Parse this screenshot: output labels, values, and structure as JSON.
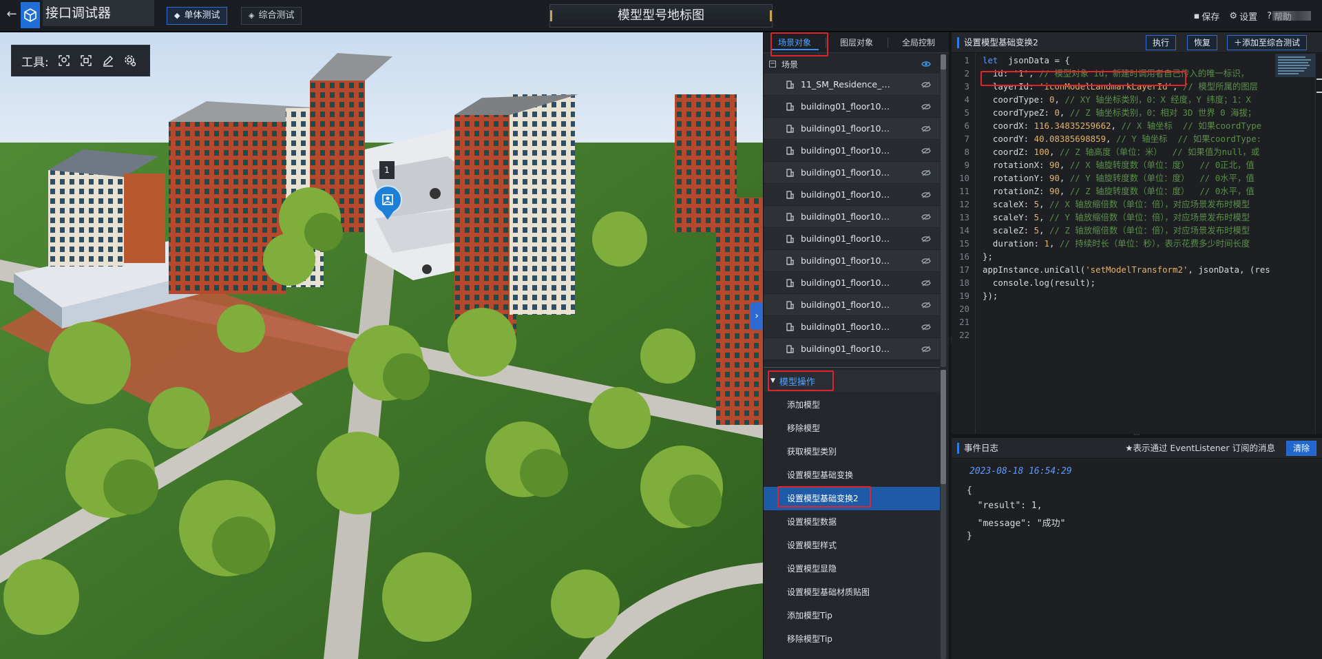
{
  "app": {
    "title": "接口调试器",
    "back_icon": "back-arrow-icon",
    "logo_icon": "cube-logo-icon"
  },
  "modes": [
    {
      "label": "单体测试",
      "active": true
    },
    {
      "label": "综合测试",
      "active": false
    }
  ],
  "page_title": "模型型号地标图",
  "top_actions": [
    {
      "label": "保存",
      "icon": "save-icon"
    },
    {
      "label": "设置",
      "icon": "settings-icon"
    },
    {
      "label": "帮助",
      "icon": "help-icon"
    }
  ],
  "toolbox": {
    "label": "工具:",
    "tools": [
      "locate-icon",
      "frame-select-icon",
      "pen-icon",
      "gear-icon"
    ]
  },
  "mid_tabs": [
    {
      "label": "场景对象",
      "active": true
    },
    {
      "label": "图层对象",
      "active": false
    },
    {
      "label": "全局控制",
      "active": false
    }
  ],
  "tree": {
    "root": "场景",
    "items": [
      "11_SM_Residence_00...",
      "building01_floor10_r...",
      "building01_floor10_r...",
      "building01_floor10_r...",
      "building01_floor10_r...",
      "building01_floor10_r...",
      "building01_floor10_r...",
      "building01_floor10_r...",
      "building01_floor10_r...",
      "building01_floor10_r...",
      "building01_floor10_r...",
      "building01_floor10_r...",
      "building01_floor10_r..."
    ]
  },
  "ops": {
    "header": "模型操作",
    "items": [
      {
        "label": "添加模型",
        "active": false
      },
      {
        "label": "移除模型",
        "active": false
      },
      {
        "label": "获取模型类别",
        "active": false
      },
      {
        "label": "设置模型基础变换",
        "active": false
      },
      {
        "label": "设置模型基础变换2",
        "active": true
      },
      {
        "label": "设置模型数据",
        "active": false
      },
      {
        "label": "设置模型样式",
        "active": false
      },
      {
        "label": "设置模型显隐",
        "active": false
      },
      {
        "label": "设置模型基础材质贴图",
        "active": false
      },
      {
        "label": "添加模型Tip",
        "active": false
      },
      {
        "label": "移除模型Tip",
        "active": false
      }
    ]
  },
  "editor": {
    "title": "设置模型基础变换2",
    "buttons": [
      "执行",
      "恢复",
      "添加至综合测试"
    ],
    "line_numbers": [
      "1",
      "2",
      "3",
      "4",
      "5",
      "6",
      "7",
      "8",
      "9",
      "10",
      "11",
      "12",
      "13",
      "14",
      "15",
      "16",
      "17",
      "18",
      "19",
      "20",
      "21",
      "22"
    ],
    "lines": [
      [
        [
          "kw",
          "let"
        ],
        [
          "",
          "  jsonData = {"
        ]
      ],
      [
        [
          "",
          "  id: "
        ],
        [
          "str",
          "'1'"
        ],
        [
          "",
          ", "
        ],
        [
          "com",
          "// 模型对象 id，新建时调用者自己传入的唯一标识，"
        ]
      ],
      [
        [
          "",
          "  layerId: "
        ],
        [
          "str",
          "'iconModelLandmarkLayerId'"
        ],
        [
          "",
          ", "
        ],
        [
          "com",
          "// 模型所属的图层"
        ]
      ],
      [
        [
          "",
          "  coordType: "
        ],
        [
          "num",
          "0"
        ],
        [
          "",
          ", "
        ],
        [
          "com",
          "// XY 轴坐标类别，0：X 经度，Y 纬度；1：X"
        ]
      ],
      [
        [
          "",
          "  coordTypeZ: "
        ],
        [
          "num",
          "0"
        ],
        [
          "",
          ", "
        ],
        [
          "com",
          "// Z 轴坐标类别，0：相对 3D 世界 0 海拔；"
        ]
      ],
      [
        [
          "",
          "  coordX: "
        ],
        [
          "num",
          "116.34835259662"
        ],
        [
          "",
          ", "
        ],
        [
          "com",
          "// X 轴坐标  // 如果coordType"
        ]
      ],
      [
        [
          "",
          "  coordY: "
        ],
        [
          "num",
          "40.08385698859"
        ],
        [
          "",
          ", "
        ],
        [
          "com",
          "// Y 轴坐标  // 如果coordType:"
        ]
      ],
      [
        [
          "",
          "  coordZ: "
        ],
        [
          "num",
          "100"
        ],
        [
          "",
          ", "
        ],
        [
          "com",
          "// Z 轴高度（单位：米）  // 如果值为null，或"
        ]
      ],
      [
        [
          "",
          "  rotationX: "
        ],
        [
          "num",
          "90"
        ],
        [
          "",
          ", "
        ],
        [
          "com",
          "// X 轴旋转度数（单位：度）  // 0正北，值"
        ]
      ],
      [
        [
          "",
          "  rotationY: "
        ],
        [
          "num",
          "90"
        ],
        [
          "",
          ", "
        ],
        [
          "com",
          "// Y 轴旋转度数（单位：度）  // 0水平，值"
        ]
      ],
      [
        [
          "",
          "  rotationZ: "
        ],
        [
          "num",
          "90"
        ],
        [
          "",
          ", "
        ],
        [
          "com",
          "// Z 轴旋转度数（单位：度）  // 0水平，值"
        ]
      ],
      [
        [
          "",
          "  scaleX: "
        ],
        [
          "num",
          "5"
        ],
        [
          "",
          ", "
        ],
        [
          "com",
          "// X 轴放缩倍数（单位：倍），对应场景发布时模型"
        ]
      ],
      [
        [
          "",
          "  scaleY: "
        ],
        [
          "num",
          "5"
        ],
        [
          "",
          ", "
        ],
        [
          "com",
          "// Y 轴放缩倍数（单位：倍），对应场景发布时模型"
        ]
      ],
      [
        [
          "",
          "  scaleZ: "
        ],
        [
          "num",
          "5"
        ],
        [
          "",
          ", "
        ],
        [
          "com",
          "// Z 轴放缩倍数（单位：倍），对应场景发布时模型"
        ]
      ],
      [
        [
          "",
          "  duration: "
        ],
        [
          "num",
          "1"
        ],
        [
          "",
          ", "
        ],
        [
          "com",
          "// 持续时长（单位：秒），表示花费多少时间长度"
        ]
      ],
      [
        [
          "",
          "};"
        ]
      ],
      [
        [
          "",
          "appInstance.uniCall("
        ],
        [
          "str",
          "'setModelTransform2'"
        ],
        [
          "",
          ", jsonData, (res"
        ]
      ],
      [
        [
          "",
          "  console.log(result);"
        ]
      ],
      [
        [
          "",
          "});"
        ]
      ],
      [
        [
          "",
          ""
        ]
      ],
      [
        [
          "",
          ""
        ]
      ],
      [
        [
          "",
          ""
        ]
      ]
    ]
  },
  "log": {
    "title": "事件日志",
    "note": "★表示通过 EventListener 订阅的消息",
    "clear_label": "清除",
    "timestamp": "2023-08-18 16:54:29",
    "lines": [
      "{",
      "  \"result\": 1,",
      "  \"message\": \"成功\"",
      "}"
    ]
  },
  "scene_badge": "1",
  "colors": {
    "accent": "#2f7de1",
    "highlight_red": "#e0242b",
    "active_item": "#1f5aa6"
  }
}
